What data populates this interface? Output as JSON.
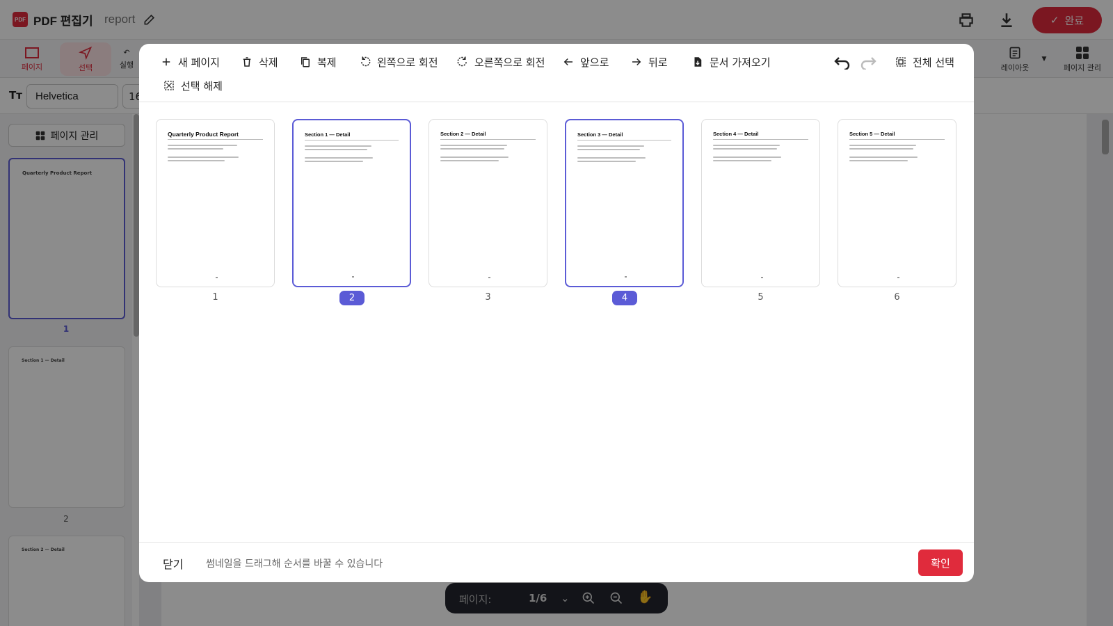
{
  "app": {
    "logo_text": "PDF",
    "title": "PDF 편집기",
    "doc_name": "report",
    "done_label": "완료",
    "brand_color": "#e02b3c",
    "accent_color": "#5b5bd6"
  },
  "tools": {
    "page_label": "페이지",
    "select_label": "선택",
    "exec_label": "실행",
    "layout_label": "레이아웃",
    "page_manage_label": "페이지 관리"
  },
  "fontbar": {
    "font": "Helvetica",
    "size": "16"
  },
  "sidebar": {
    "manage_button": "페이지 관리",
    "pages": [
      {
        "num": "1",
        "title": "Quarterly Product Report"
      },
      {
        "num": "2",
        "title": "Section 1 — Detail"
      },
      {
        "num": "3",
        "title": "Section 2 — Detail"
      }
    ]
  },
  "pagebar": {
    "label": "페이지:",
    "current": "1/6"
  },
  "modal": {
    "toolbar": {
      "new_page": "새 페이지",
      "delete": "삭제",
      "duplicate": "복제",
      "rotate_left": "왼쪽으로 회전",
      "rotate_right": "오른쪽으로 회전",
      "forward": "앞으로",
      "backward": "뒤로",
      "import_doc": "문서 가져오기",
      "select_all": "전체 선택",
      "deselect": "선택 해제"
    },
    "pages": [
      {
        "num": "1",
        "title": "Quarterly Product Report",
        "selected": false
      },
      {
        "num": "2",
        "title": "Section 1 — Detail",
        "selected": true
      },
      {
        "num": "3",
        "title": "Section 2 — Detail",
        "selected": false
      },
      {
        "num": "4",
        "title": "Section 3 — Detail",
        "selected": true
      },
      {
        "num": "5",
        "title": "Section 4 — Detail",
        "selected": false
      },
      {
        "num": "6",
        "title": "Section 5 — Detail",
        "selected": false
      }
    ],
    "footer": {
      "close": "닫기",
      "hint": "썸네일을 드래그해 순서를 바꿀 수 있습니다",
      "confirm": "확인"
    }
  }
}
